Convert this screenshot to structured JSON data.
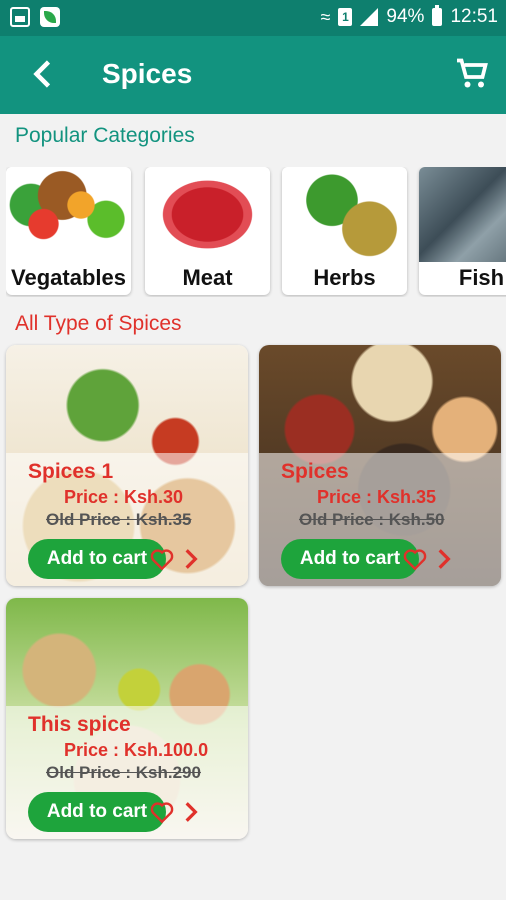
{
  "status_bar": {
    "wifi": "wifi",
    "sim": "1",
    "battery": "94%",
    "time": "12:51"
  },
  "app_bar": {
    "title": "Spices"
  },
  "sections": {
    "popular": "Popular Categories",
    "all": "All Type of Spices"
  },
  "categories": [
    {
      "label": "Vegatables"
    },
    {
      "label": "Meat"
    },
    {
      "label": "Herbs"
    },
    {
      "label": "Fish"
    }
  ],
  "products": [
    {
      "name": "Spices 1",
      "price": "Price : Ksh.30",
      "old_price": "Old Price : Ksh.35",
      "button": "Add to cart"
    },
    {
      "name": "Spices",
      "price": "Price : Ksh.35",
      "old_price": "Old Price : Ksh.50",
      "button": "Add to cart"
    },
    {
      "name": "This spice",
      "price": "Price : Ksh.100.0",
      "old_price": "Old Price : Ksh.290",
      "button": "Add to cart"
    }
  ],
  "colors": {
    "primary": "#12937f",
    "status_bar": "#0e7f6e",
    "accent_red": "#e0312b",
    "button_green": "#1ea43c"
  }
}
